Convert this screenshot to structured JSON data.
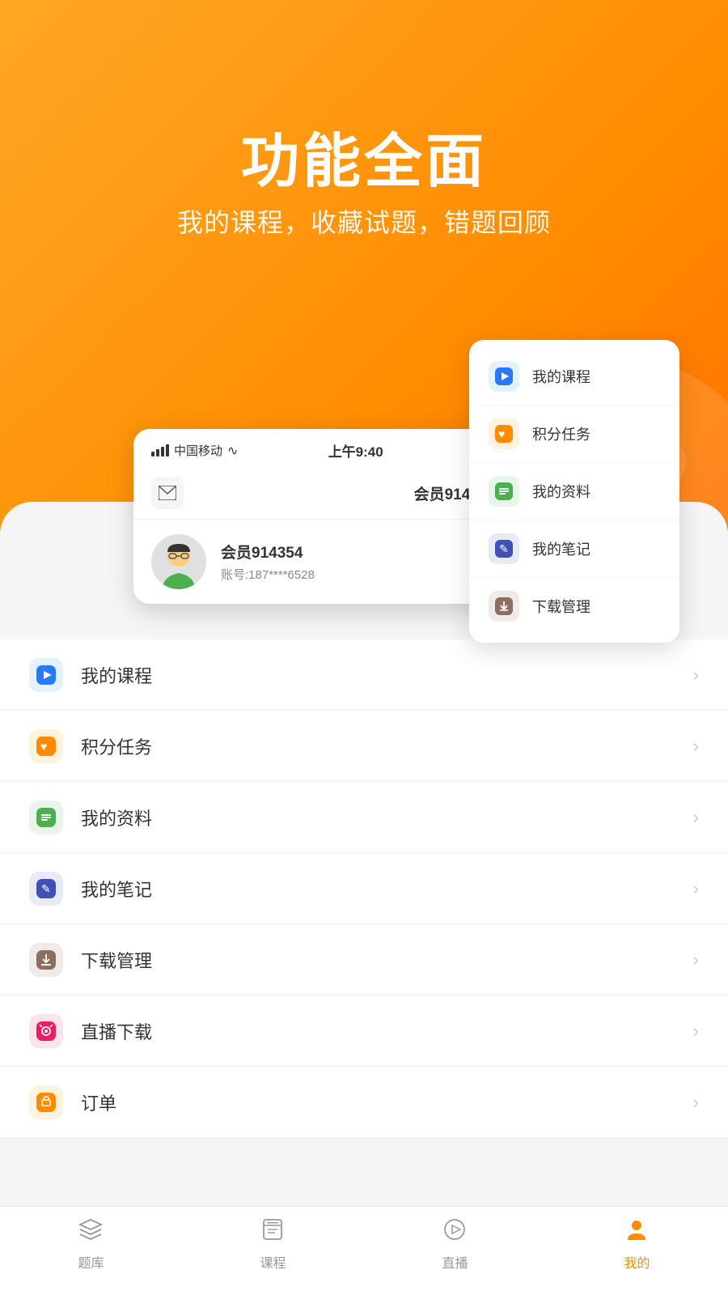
{
  "hero": {
    "title": "功能全面",
    "subtitle": "我的课程，收藏试题，错题回顾"
  },
  "phone": {
    "status": {
      "carrier": "中国移动",
      "time": "上午9:40"
    },
    "header": {
      "member_id": "会员914354"
    },
    "profile": {
      "name": "会员914354",
      "account": "账号:187****6528"
    }
  },
  "floating_menu": {
    "items": [
      {
        "label": "我的课程",
        "icon_color": "#2979FF",
        "icon": "▶"
      },
      {
        "label": "积分任务",
        "icon_color": "#FF8C00",
        "icon": "♥"
      },
      {
        "label": "我的资料",
        "icon_color": "#4CAF50",
        "icon": "≡"
      },
      {
        "label": "我的笔记",
        "icon_color": "#3F51B5",
        "icon": "✎"
      },
      {
        "label": "下载管理",
        "icon_color": "#8D6E63",
        "icon": "↓"
      }
    ]
  },
  "list_items": [
    {
      "label": "我的课程",
      "icon_color": "#2979FF",
      "bg_color": "#E3F2FD",
      "icon": "▶"
    },
    {
      "label": "积分任务",
      "icon_color": "#FF8C00",
      "bg_color": "#FFF3E0",
      "icon": "♥"
    },
    {
      "label": "我的资料",
      "icon_color": "#4CAF50",
      "bg_color": "#E8F5E9",
      "icon": "≡"
    },
    {
      "label": "我的笔记",
      "icon_color": "#3F51B5",
      "bg_color": "#E8EAF6",
      "icon": "✎"
    },
    {
      "label": "下载管理",
      "icon_color": "#8D6E63",
      "bg_color": "#EFEBE9",
      "icon": "↓"
    },
    {
      "label": "直播下载",
      "icon_color": "#E91E63",
      "bg_color": "#FCE4EC",
      "icon": "⊙"
    },
    {
      "label": "订单",
      "icon_color": "#FF8C00",
      "bg_color": "#FFF3E0",
      "icon": "☰"
    }
  ],
  "bottom_nav": {
    "items": [
      {
        "label": "题库",
        "icon": "layers",
        "active": false
      },
      {
        "label": "课程",
        "icon": "book",
        "active": false
      },
      {
        "label": "直播",
        "icon": "play-circle",
        "active": false
      },
      {
        "label": "我的",
        "icon": "person",
        "active": true
      }
    ]
  }
}
